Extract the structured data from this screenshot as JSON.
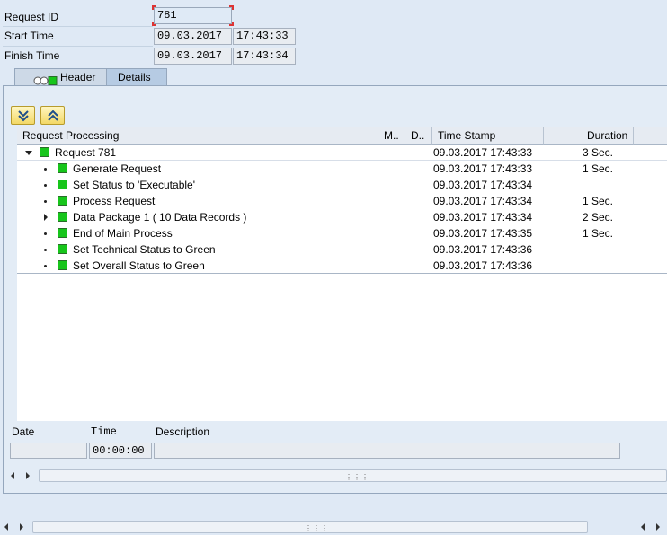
{
  "form": {
    "request_id_label": "Request ID",
    "request_id_value": "781",
    "start_time_label": "Start Time",
    "start_date": "09.03.2017",
    "start_time": "17:43:33",
    "finish_time_label": "Finish Time",
    "finish_date": "09.03.2017",
    "finish_time": "17:43:34"
  },
  "tabs": [
    {
      "label": "Header",
      "active": false
    },
    {
      "label": "Details",
      "active": true
    }
  ],
  "toolbar": {
    "expand_icon": "expand-all-icon",
    "collapse_icon": "collapse-all-icon"
  },
  "tree": {
    "columns": [
      "Request Processing",
      "M..",
      "D..",
      "Time Stamp",
      "Duration"
    ],
    "rows": [
      {
        "label": "Request 781",
        "time": "09.03.2017 17:43:33",
        "duration": "3 Sec.",
        "level": 0,
        "node": "expanded"
      },
      {
        "label": "Generate Request",
        "time": "09.03.2017 17:43:33",
        "duration": "1 Sec.",
        "level": 1,
        "node": "leaf"
      },
      {
        "label": "Set Status to 'Executable'",
        "time": "09.03.2017 17:43:34",
        "duration": "",
        "level": 1,
        "node": "leaf"
      },
      {
        "label": "Process Request",
        "time": "09.03.2017 17:43:34",
        "duration": "1 Sec.",
        "level": 1,
        "node": "leaf"
      },
      {
        "label": "Data Package 1 ( 10 Data Records )",
        "time": "09.03.2017 17:43:34",
        "duration": "2 Sec.",
        "level": 1,
        "node": "collapsed"
      },
      {
        "label": "End of Main Process",
        "time": "09.03.2017 17:43:35",
        "duration": "1 Sec.",
        "level": 1,
        "node": "leaf"
      },
      {
        "label": "Set Technical Status to Green",
        "time": "09.03.2017 17:43:36",
        "duration": "",
        "level": 1,
        "node": "leaf"
      },
      {
        "label": "Set Overall Status to Green",
        "time": "09.03.2017 17:43:36",
        "duration": "",
        "level": 1,
        "node": "leaf"
      }
    ]
  },
  "details": {
    "date_label": "Date",
    "time_label": "Time",
    "description_label": "Description",
    "date_value": "",
    "time_value": "00:00:00",
    "description_value": ""
  },
  "colors": {
    "status_green": "#17c51b",
    "background": "#dfe9f5"
  }
}
